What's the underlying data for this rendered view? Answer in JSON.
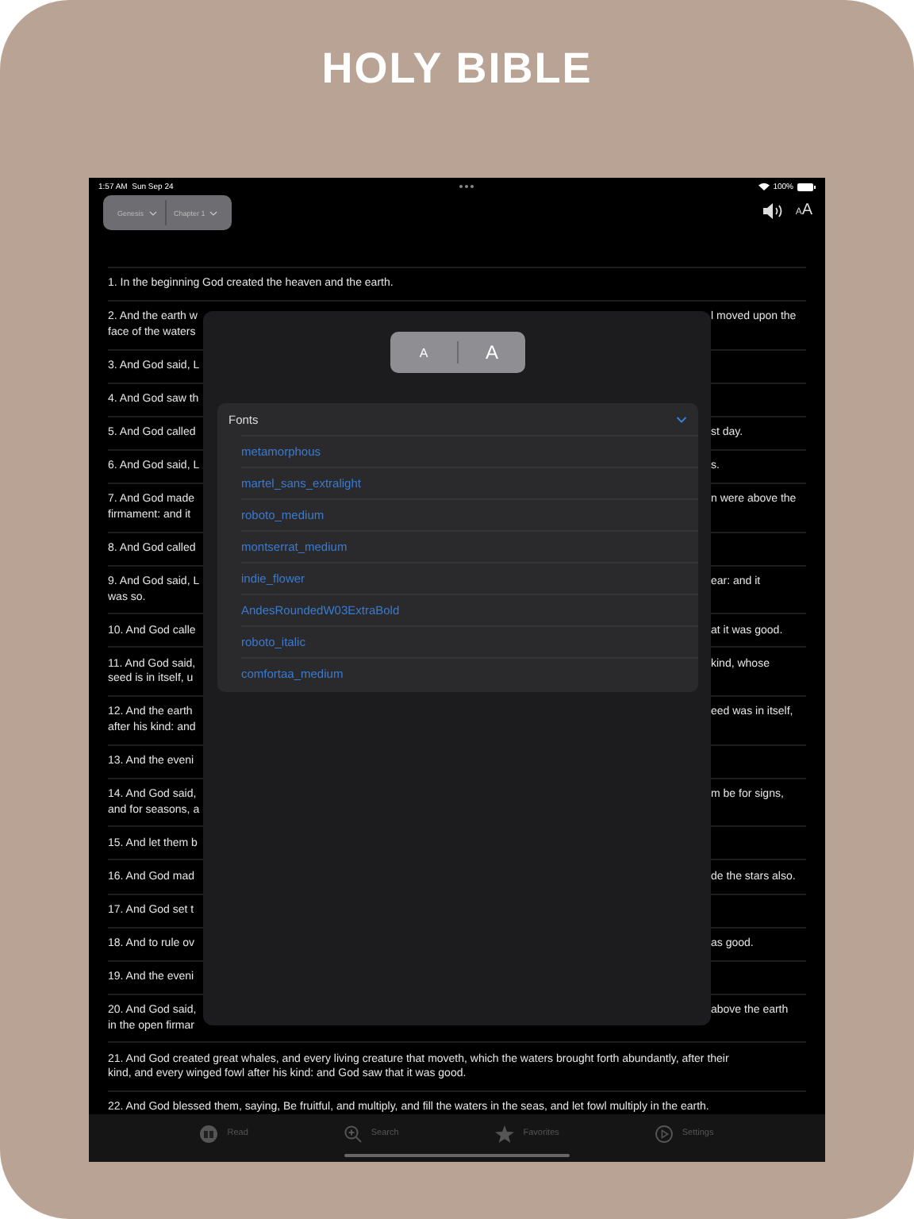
{
  "banner_title": "HOLY BIBLE",
  "status_bar": {
    "time": "1:57 AM",
    "date": "Sun Sep 24",
    "battery": "100%"
  },
  "toolbar": {
    "book": "Genesis",
    "chapter": "Chapter 1",
    "text_size_small": "A",
    "text_size_large": "A"
  },
  "verses": [
    {
      "kind": "full",
      "lines": [
        "1. In the beginning God created the heaven and the earth."
      ]
    },
    {
      "kind": "covered",
      "start": [
        "2. And the earth w",
        "face of the waters"
      ],
      "end": [
        "l moved upon the"
      ]
    },
    {
      "kind": "covered",
      "start": [
        "3. And God said, L"
      ]
    },
    {
      "kind": "covered",
      "start": [
        "4. And God saw th"
      ]
    },
    {
      "kind": "covered",
      "start": [
        "5. And God called"
      ],
      "end": [
        "st day."
      ]
    },
    {
      "kind": "covered",
      "start": [
        "6. And God said, L"
      ],
      "end": [
        "s."
      ]
    },
    {
      "kind": "covered",
      "start": [
        "7. And God made",
        "firmament: and it"
      ],
      "end": [
        "n were above the"
      ]
    },
    {
      "kind": "covered",
      "start": [
        "8. And God called"
      ]
    },
    {
      "kind": "covered",
      "start": [
        "9. And God said, L",
        "was so."
      ],
      "end": [
        "ear: and it"
      ]
    },
    {
      "kind": "covered",
      "start": [
        "10. And God calle"
      ],
      "end": [
        "at it was good."
      ]
    },
    {
      "kind": "covered",
      "start": [
        "11. And God said,",
        "seed is in itself, u"
      ],
      "end": [
        "kind, whose"
      ]
    },
    {
      "kind": "covered",
      "start": [
        "12. And the earth",
        "after his kind: and"
      ],
      "end": [
        "eed was in itself,"
      ]
    },
    {
      "kind": "covered",
      "start": [
        "13. And the eveni"
      ]
    },
    {
      "kind": "covered",
      "start": [
        "14. And God said,",
        "and for seasons, a"
      ],
      "end": [
        "m be for signs,"
      ]
    },
    {
      "kind": "covered",
      "start": [
        "15. And let them b"
      ]
    },
    {
      "kind": "covered",
      "start": [
        "16. And God mad"
      ],
      "end": [
        "de the stars also."
      ]
    },
    {
      "kind": "covered",
      "start": [
        "17. And God set t"
      ]
    },
    {
      "kind": "covered",
      "start": [
        "18. And to rule ov"
      ],
      "end": [
        "as good."
      ]
    },
    {
      "kind": "covered",
      "start": [
        "19. And the eveni"
      ]
    },
    {
      "kind": "covered",
      "start": [
        "20. And God said,",
        "in the open firmar"
      ],
      "end": [
        "above the earth"
      ]
    },
    {
      "kind": "full",
      "lines": [
        "21. And God created great whales, and every living creature that moveth, which the waters brought forth abundantly, after their",
        "kind, and every winged fowl after his kind: and God saw that it was good."
      ]
    },
    {
      "kind": "full",
      "lines": [
        "22. And God blessed them, saying, Be fruitful, and multiply, and fill the waters in the seas, and let fowl multiply in the earth."
      ]
    }
  ],
  "font_dialog": {
    "size_small": "A",
    "size_large": "A",
    "fonts": {
      "label": "Fonts",
      "expanded": true,
      "items": [
        "metamorphous",
        "martel_sans_extralight",
        "roboto_medium",
        "montserrat_medium",
        "indie_flower",
        "AndesRoundedW03ExtraBold",
        "roboto_italic",
        "comfortaa_medium"
      ]
    }
  },
  "tabs": [
    {
      "kind": "read",
      "label": "Read"
    },
    {
      "kind": "search",
      "label": "Search"
    },
    {
      "kind": "favorites",
      "label": "Favorites"
    },
    {
      "kind": "settings",
      "label": "Settings"
    }
  ]
}
